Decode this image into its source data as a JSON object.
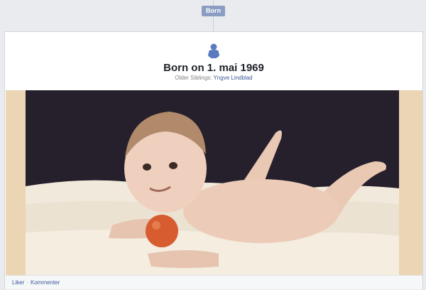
{
  "timeline": {
    "badge_label": "Born"
  },
  "event": {
    "icon": "baby-icon",
    "title": "Born on 1. mai 1969",
    "siblings_label": "Older Siblings:",
    "sibling_name": "Yngve Lindblad"
  },
  "footer": {
    "like_label": "Liker",
    "separator": "·",
    "comment_label": "Kommenter"
  },
  "colors": {
    "link": "#3b5998",
    "badge": "#8b9dc3",
    "background": "#e9ebee",
    "icon": "#5b7bc0"
  }
}
